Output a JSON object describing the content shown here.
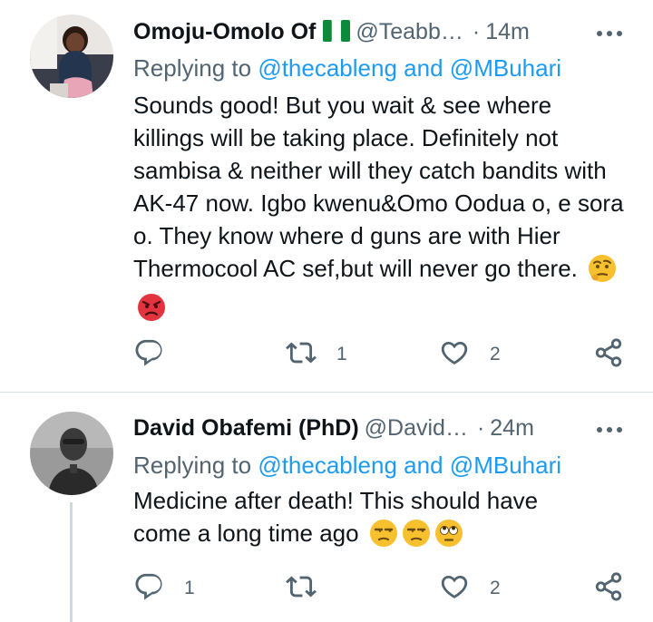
{
  "colors": {
    "text": "#0f1419",
    "secondary": "#536471",
    "link": "#1d9bf0",
    "divider": "#d8dfe3",
    "thread_line": "#cfd9de"
  },
  "tweets": [
    {
      "display_name": "Omoju-Omolo Of",
      "name_icon": "nigeria-flag-icon",
      "handle": "@Teabb…",
      "separator": "·",
      "time": "14m",
      "replying_label": "Replying to",
      "mention_1": "@thecableng",
      "and_label": "and",
      "mention_2": "@MBuhari",
      "text": "Sounds good! But you wait & see where killings will be taking place. Definitely not sambisa & neither will they catch bandits with AK-47 now. Igbo kwenu&Omo Oodua o, e sora o. They know where d guns are with Hier Thermocool AC sef,but will never go there.",
      "emojis": [
        "face-with-raised-eyebrow-icon",
        "angry-face-icon"
      ],
      "reply_count": "",
      "retweet_count": "1",
      "like_count": "2"
    },
    {
      "display_name": "David Obafemi (PhD)",
      "handle": "@David…",
      "separator": "·",
      "time": "24m",
      "replying_label": "Replying to",
      "mention_1": "@thecableng",
      "and_label": "and",
      "mention_2": "@MBuhari",
      "text": "Medicine after death! This should have come a long time ago",
      "emojis": [
        "unamused-face-icon",
        "unamused-face-icon",
        "eye-roll-face-icon"
      ],
      "reply_count": "1",
      "retweet_count": "",
      "like_count": "2"
    }
  ]
}
